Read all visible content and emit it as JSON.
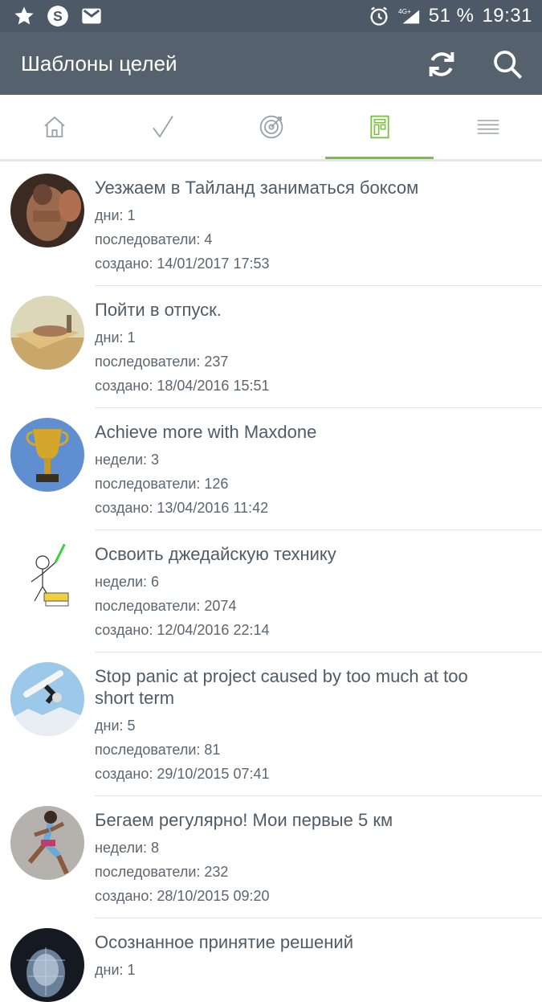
{
  "status": {
    "battery": "51 %",
    "time": "19:31",
    "network": "4G+"
  },
  "appbar": {
    "title": "Шаблоны целей"
  },
  "tabs": [
    {
      "icon": "home-icon"
    },
    {
      "icon": "check-icon"
    },
    {
      "icon": "target-icon"
    },
    {
      "icon": "template-icon",
      "active": true
    },
    {
      "icon": "menu-icon"
    }
  ],
  "labels": {
    "followers": "последователи:",
    "created": "создано:"
  },
  "items": [
    {
      "title": "Уезжаем в Тайланд заниматься боксом",
      "duration_label": "дни:",
      "duration": "1",
      "followers": "4",
      "created": "14/01/2017 17:53"
    },
    {
      "title": "Пойти в отпуск.",
      "duration_label": "дни:",
      "duration": "1",
      "followers": "237",
      "created": "18/04/2016 15:51"
    },
    {
      "title": "Achieve more with Maxdone",
      "duration_label": "недели:",
      "duration": "3",
      "followers": "126",
      "created": "13/04/2016 11:42"
    },
    {
      "title": "Освоить джедайскую технику",
      "duration_label": "недели:",
      "duration": "6",
      "followers": "2074",
      "created": "12/04/2016 22:14"
    },
    {
      "title": "Stop panic at project caused by too much at too short term",
      "duration_label": "дни:",
      "duration": "5",
      "followers": "81",
      "created": "29/10/2015 07:41"
    },
    {
      "title": "Бегаем регулярно! Мои первые 5 км",
      "duration_label": "недели:",
      "duration": "8",
      "followers": "232",
      "created": "28/10/2015 09:20"
    },
    {
      "title": "Осознанное принятие решений",
      "duration_label": "дни:",
      "duration": "1",
      "followers": "",
      "created": ""
    }
  ],
  "colors": {
    "statusbar": "#4d5966",
    "appbar": "#56616e",
    "accent": "#7bc043"
  }
}
